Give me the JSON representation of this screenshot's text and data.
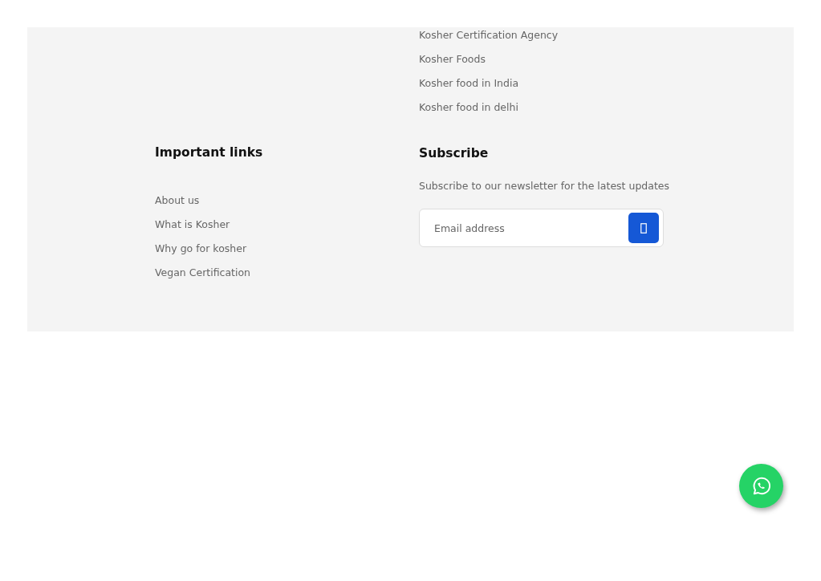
{
  "top_links": [
    "Kosher Certification Agency",
    "Kosher Foods",
    "Kosher food in India",
    "Kosher food in delhi"
  ],
  "important_links": {
    "title": "Important links",
    "items": [
      "About us",
      "What is Kosher",
      "Why go for kosher",
      "Vegan Certification"
    ]
  },
  "subscribe": {
    "title": "Subscribe",
    "text": "Subscribe to our newsletter for the latest updates",
    "placeholder": "Email address"
  }
}
